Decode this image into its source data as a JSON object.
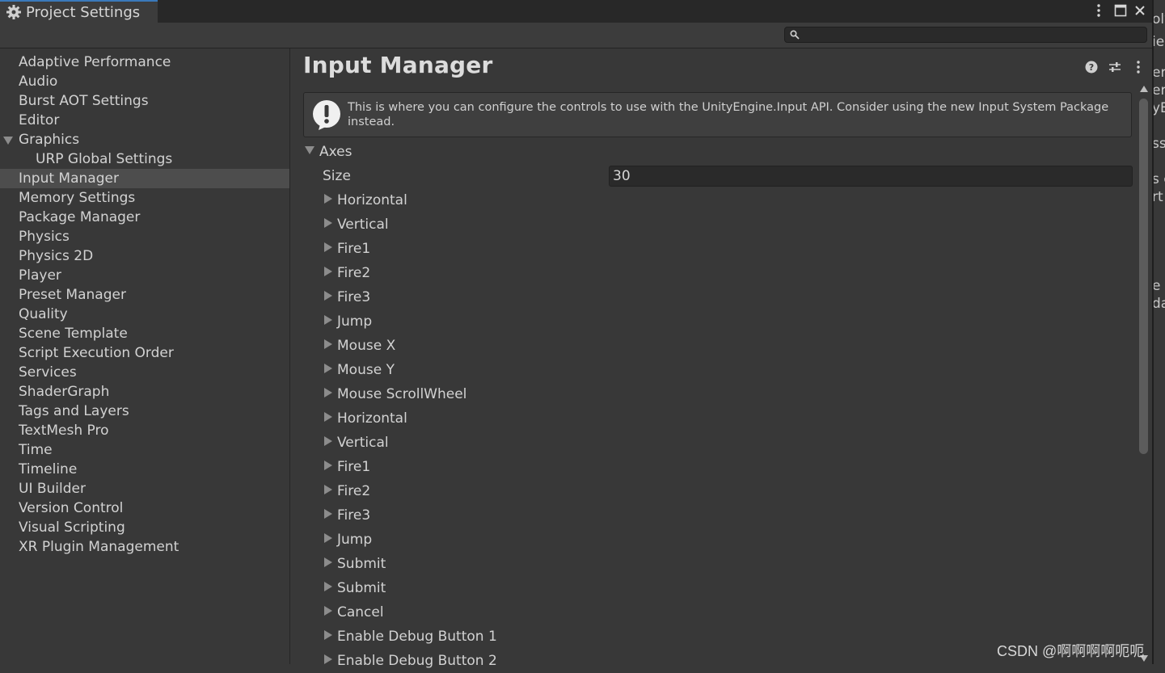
{
  "window": {
    "tab_title": "Project Settings",
    "icons": [
      "gear-icon",
      "more-vertical-icon",
      "maximize-icon",
      "close-icon"
    ]
  },
  "search": {
    "value": "",
    "placeholder": ""
  },
  "sidebar": {
    "selected": "Input Manager",
    "items": [
      {
        "label": "Adaptive Performance",
        "level": 0
      },
      {
        "label": "Audio",
        "level": 0
      },
      {
        "label": "Burst AOT Settings",
        "level": 0
      },
      {
        "label": "Editor",
        "level": 0
      },
      {
        "label": "Graphics",
        "level": 0,
        "expanded": true
      },
      {
        "label": "URP Global Settings",
        "level": 1
      },
      {
        "label": "Input Manager",
        "level": 0
      },
      {
        "label": "Memory Settings",
        "level": 0
      },
      {
        "label": "Package Manager",
        "level": 0
      },
      {
        "label": "Physics",
        "level": 0
      },
      {
        "label": "Physics 2D",
        "level": 0
      },
      {
        "label": "Player",
        "level": 0
      },
      {
        "label": "Preset Manager",
        "level": 0
      },
      {
        "label": "Quality",
        "level": 0
      },
      {
        "label": "Scene Template",
        "level": 0
      },
      {
        "label": "Script Execution Order",
        "level": 0
      },
      {
        "label": "Services",
        "level": 0
      },
      {
        "label": "ShaderGraph",
        "level": 0
      },
      {
        "label": "Tags and Layers",
        "level": 0
      },
      {
        "label": "TextMesh Pro",
        "level": 0
      },
      {
        "label": "Time",
        "level": 0
      },
      {
        "label": "Timeline",
        "level": 0
      },
      {
        "label": "UI Builder",
        "level": 0
      },
      {
        "label": "Version Control",
        "level": 0
      },
      {
        "label": "Visual Scripting",
        "level": 0
      },
      {
        "label": "XR Plugin Management",
        "level": 0
      }
    ]
  },
  "content": {
    "title": "Input Manager",
    "header_icons": [
      "help-icon",
      "preset-sliders-icon",
      "more-vertical-icon"
    ],
    "helpbox": "This is where you can configure the controls to use with the UnityEngine.Input API. Consider using the new Input System Package instead.",
    "axes": {
      "label": "Axes",
      "size_label": "Size",
      "size_value": "30",
      "items": [
        "Horizontal",
        "Vertical",
        "Fire1",
        "Fire2",
        "Fire3",
        "Jump",
        "Mouse X",
        "Mouse Y",
        "Mouse ScrollWheel",
        "Horizontal",
        "Vertical",
        "Fire1",
        "Fire2",
        "Fire3",
        "Jump",
        "Submit",
        "Submit",
        "Cancel",
        "Enable Debug Button 1",
        "Enable Debug Button 2"
      ]
    }
  },
  "background_window": {
    "fragments": [
      "oly",
      "ie",
      "er",
      "er",
      "yE",
      "ss",
      "s c",
      "rt",
      "e",
      "da"
    ]
  },
  "watermark": "CSDN @啊啊啊啊呃呃",
  "colors": {
    "background": "#383838",
    "selected_row": "#4d4d4d",
    "field": "#2a2a2a",
    "text": "#d2d2d2"
  }
}
